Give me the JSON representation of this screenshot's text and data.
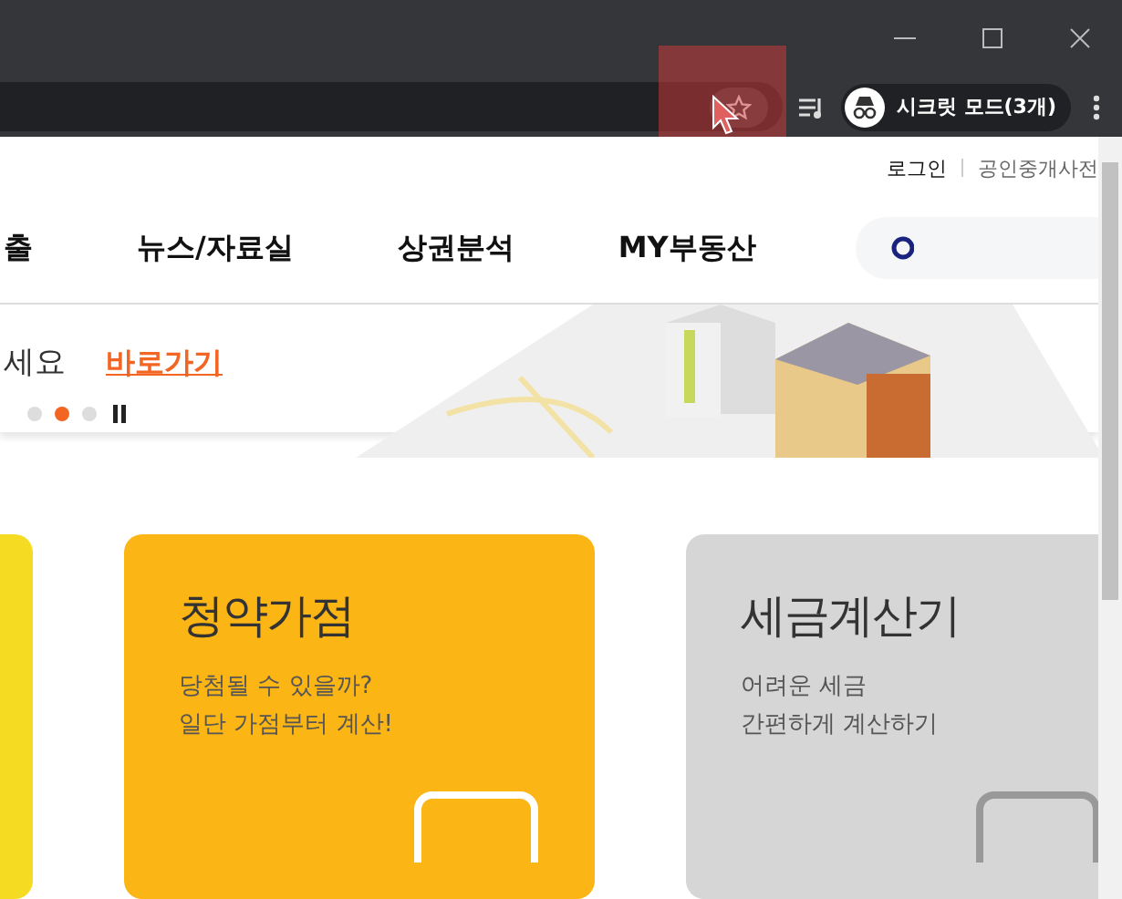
{
  "browser": {
    "bookmark_highlighted": true,
    "profile": {
      "label": "시크릿 모드(3개)"
    }
  },
  "top_links": [
    {
      "label": "로그인"
    },
    {
      "label": "공인중개사전"
    }
  ],
  "nav": [
    {
      "label": "출"
    },
    {
      "label": "뉴스/자료실"
    },
    {
      "label": "상권분석"
    },
    {
      "label": "MY부동산"
    }
  ],
  "banner": {
    "text": "세요",
    "link": "바로가기",
    "dots": [
      {
        "selected": false
      },
      {
        "selected": true
      },
      {
        "selected": false
      }
    ]
  },
  "cards": [
    {
      "kind": "partial",
      "color": "#f5dc22"
    },
    {
      "kind": "full",
      "color": "#fbb514",
      "title": "청약가점",
      "lines": [
        "당첨될 수 있을까?",
        "일단 가점부터 계산!"
      ]
    },
    {
      "kind": "full",
      "color": "#d7d6d7",
      "title": "세금계산기",
      "lines": [
        "어려운 세금",
        "간편하게 계산하기"
      ]
    }
  ]
}
